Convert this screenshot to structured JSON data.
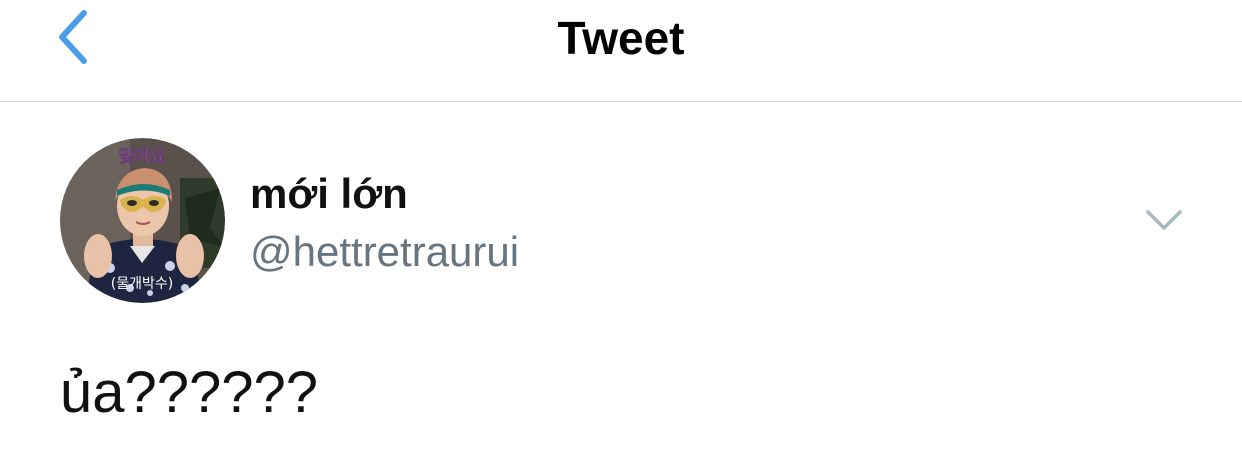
{
  "navbar": {
    "title": "Tweet",
    "back_icon": "chevron-left-icon",
    "accent_color": "#4a9ee8"
  },
  "tweet": {
    "author": {
      "display_name": "mới lớn",
      "handle": "@hettretraurui",
      "avatar_caption_top": "맞아요",
      "avatar_caption_bottom": "(물개박수)"
    },
    "more_icon": "chevron-down-icon",
    "text": "ủa??????"
  },
  "colors": {
    "text_primary": "#111111",
    "text_secondary": "#66757f",
    "divider": "#cfd3d6",
    "icon_muted": "#aab8c2"
  }
}
